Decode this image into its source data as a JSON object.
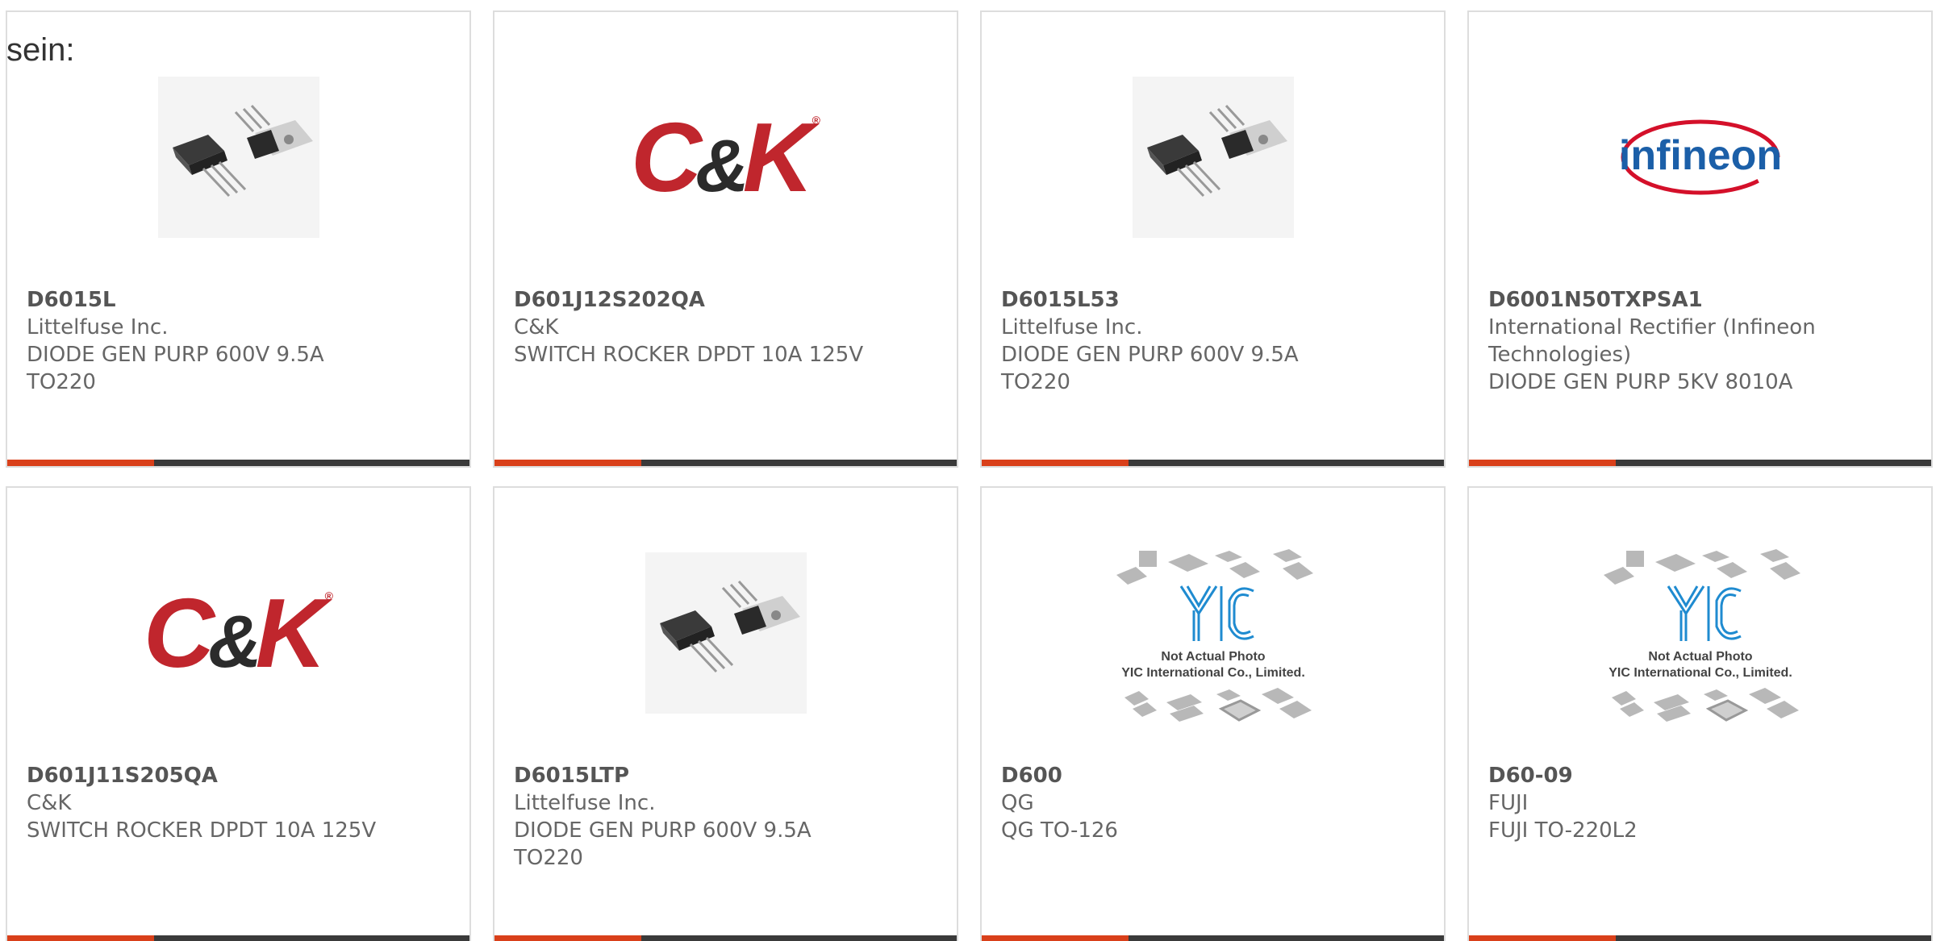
{
  "intro_text": "sein:",
  "colors": {
    "accent": "#d9401a",
    "bar": "#3a3a3a",
    "ck_red": "#c0262d",
    "infineon_blue": "#1b5fa8",
    "infineon_red": "#d4102a"
  },
  "image_captions": {
    "yic_line1": "Not Actual Photo",
    "yic_line2": "YIC International Co., Limited."
  },
  "products": [
    {
      "part_number": "D6015L",
      "manufacturer": "Littelfuse Inc.",
      "description": "DIODE GEN PURP 600V 9.5A TO220",
      "image": "to220-photo"
    },
    {
      "part_number": "D601J12S202QA",
      "manufacturer": "C&K",
      "description": "SWITCH ROCKER DPDT 10A 125V",
      "image": "ck-logo",
      "logo": {
        "c": "C",
        "amp": "&",
        "k": "K",
        "reg": "®"
      }
    },
    {
      "part_number": "D6015L53",
      "manufacturer": "Littelfuse Inc.",
      "description": "DIODE GEN PURP 600V 9.5A TO220",
      "image": "to220-photo"
    },
    {
      "part_number": "D6001N50TXPSA1",
      "manufacturer": "International Rectifier (Infineon Technologies)",
      "description": "DIODE GEN PURP 5KV 8010A",
      "image": "infineon-logo",
      "logo_text": "infineon"
    },
    {
      "part_number": "D601J11S205QA",
      "manufacturer": "C&K",
      "description": "SWITCH ROCKER DPDT 10A 125V",
      "image": "ck-logo",
      "logo": {
        "c": "C",
        "amp": "&",
        "k": "K",
        "reg": "®"
      }
    },
    {
      "part_number": "D6015LTP",
      "manufacturer": "Littelfuse Inc.",
      "description": "DIODE GEN PURP 600V 9.5A TO220",
      "image": "to220-photo"
    },
    {
      "part_number": "D600",
      "manufacturer": "QG",
      "description": "QG TO-126",
      "image": "yic-placeholder"
    },
    {
      "part_number": "D60-09",
      "manufacturer": "FUJI",
      "description": "FUJI TO-220L2",
      "image": "yic-placeholder"
    }
  ]
}
